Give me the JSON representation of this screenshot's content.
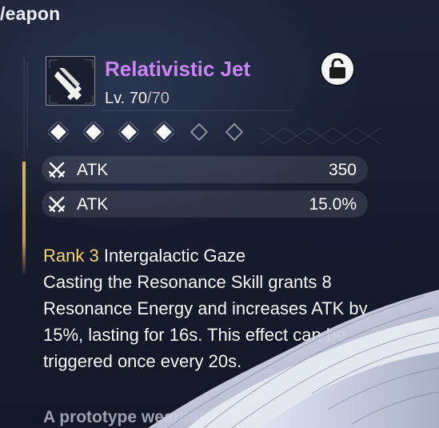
{
  "header": {
    "title": "/eapon"
  },
  "weapon": {
    "name": "Relativistic Jet",
    "level_prefix": "Lv. ",
    "level_current": "70",
    "level_max": "/70"
  },
  "rank": {
    "filled": 4,
    "total": 6
  },
  "stats": [
    {
      "icon": "crossed-swords-icon",
      "name": "ATK",
      "value": "350"
    },
    {
      "icon": "crossed-swords-icon",
      "name": "ATK",
      "value": "15.0%"
    }
  ],
  "passive": {
    "rank_label": "Rank 3",
    "title": " Intergalactic Gaze",
    "description": "Casting the Resonance Skill grants 8 Resonance Energy and increases ATK by 15%, lasting for 16s. This effect can be triggered once every 20s."
  },
  "lore": {
    "text": "A prototype weapon designed by the"
  },
  "colors": {
    "name_purple": "#c986f2",
    "rank_gold": "#f2d473",
    "accent_gold": "#d8b26a"
  }
}
